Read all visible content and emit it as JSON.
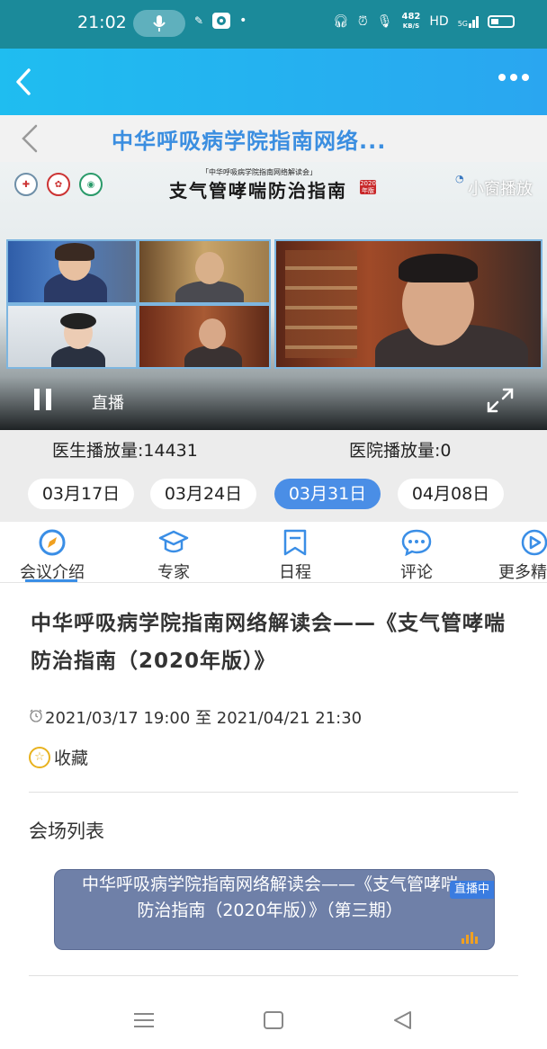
{
  "status_bar": {
    "time": "21:02",
    "net_speed_value": "482",
    "net_speed_unit": "KB/S",
    "hd": "HD",
    "signal": "5G",
    "icons": [
      "mic-icon",
      "wechat-icon",
      "screen-record-icon",
      "headset-icon",
      "alarm-icon",
      "mic-small-icon",
      "signal-icon",
      "battery-icon"
    ]
  },
  "app_bar": {
    "back_icon": "chevron-left-icon",
    "more_icon": "more-dots-icon"
  },
  "title_bar": {
    "title": "中华呼吸病学院指南网络..."
  },
  "video": {
    "banner_small": "「中华呼吸病学院指南网络解读会」",
    "banner_title": "支气管哮喘防治指南",
    "banner_badge": "2020年版",
    "mini_play": "小窗播放",
    "live_label": "直播"
  },
  "stats": {
    "doctor_plays": "医生播放量:14431",
    "hospital_plays": "医院播放量:0"
  },
  "dates": [
    {
      "label": "03月17日",
      "active": false
    },
    {
      "label": "03月24日",
      "active": false
    },
    {
      "label": "03月31日",
      "active": true
    },
    {
      "label": "04月08日",
      "active": false
    }
  ],
  "tabs": [
    {
      "label": "会议介绍",
      "icon": "compass-icon"
    },
    {
      "label": "专家",
      "icon": "graduation-cap-icon"
    },
    {
      "label": "日程",
      "icon": "bookmark-icon"
    },
    {
      "label": "评论",
      "icon": "chat-bubble-icon"
    },
    {
      "label": "更多精",
      "icon": "play-circle-icon"
    }
  ],
  "content": {
    "title": "中华呼吸病学院指南网络解读会——《支气管哮喘防治指南（2020年版）》",
    "datetime": "2021/03/17 19:00 至 2021/04/21 21:30",
    "favorite": "收藏",
    "venue_list_title": "会场列表",
    "venue": {
      "name": "中华呼吸病学院指南网络解读会——《支气管哮喘防治指南（2020年版）》（第三期）",
      "badge": "直播中"
    }
  },
  "colors": {
    "status_bar": "#1b8a9a",
    "app_bar": "#24b0f0",
    "accent": "#4a8ee6",
    "venue_card": "#6f80a8"
  }
}
